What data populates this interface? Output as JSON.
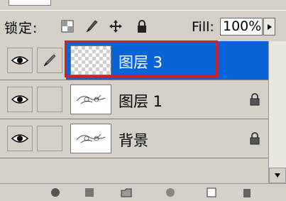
{
  "lock_bar": {
    "label": "锁定:",
    "fill_label": "Fill:",
    "fill_value": "100%",
    "icons": [
      "lock-transparent-pixels-icon",
      "lock-image-pixels-icon",
      "lock-position-icon",
      "lock-all-icon"
    ]
  },
  "layers": [
    {
      "name": "图层 3",
      "selected": true,
      "visible": true,
      "locked": false,
      "thumbnail": "transparent"
    },
    {
      "name": "图层 1",
      "selected": false,
      "visible": true,
      "locked": true,
      "thumbnail": "sketch"
    },
    {
      "name": "背景",
      "selected": false,
      "visible": true,
      "locked": true,
      "thumbnail": "sketch"
    }
  ],
  "colors": {
    "selection": "#0a64d8",
    "highlight_box": "#d42020",
    "panel": "#d4d0c8"
  }
}
